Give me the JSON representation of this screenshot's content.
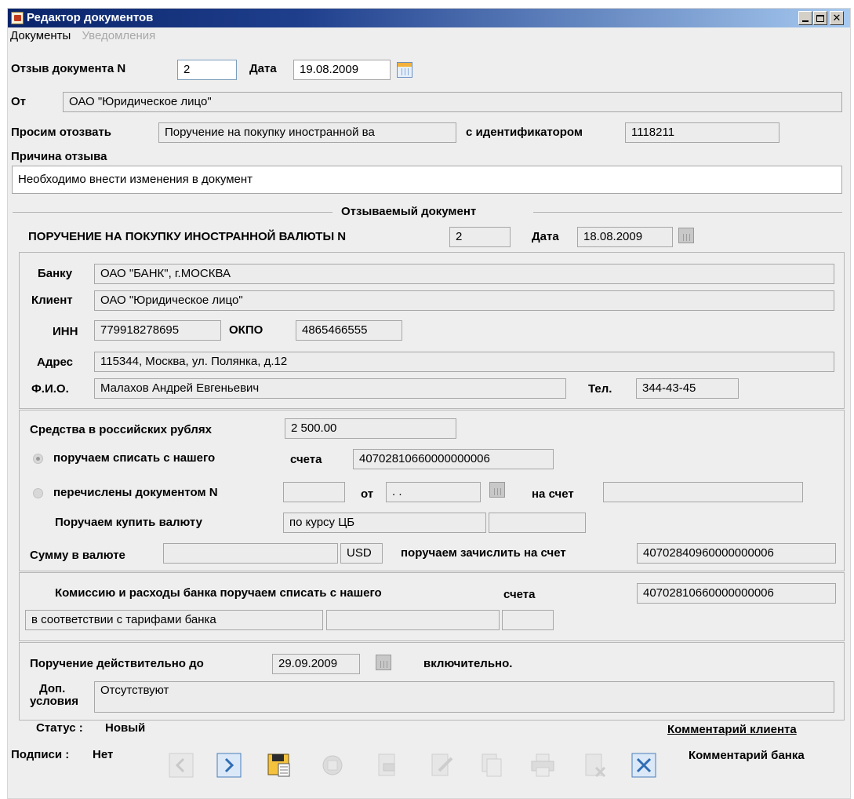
{
  "window": {
    "title": "Редактор документов"
  },
  "menu": {
    "items": [
      {
        "label": "Документы",
        "enabled": true
      },
      {
        "label": "Уведомления",
        "enabled": false
      }
    ]
  },
  "recall": {
    "doc_number_label": "Отзыв документа N",
    "doc_number_value": "2",
    "date_label": "Дата",
    "date_value": "19.08.2009",
    "from_label": "От",
    "from_value": "ОАО \"Юридическое лицо\"",
    "request_label": "Просим отозвать",
    "request_value": "Поручение на покупку иностранной ва",
    "identifier_label": "с идентификатором",
    "identifier_value": "1118211",
    "reason_label": "Причина отзыва",
    "reason_value": "Необходимо внести изменения в документ"
  },
  "recalled_doc": {
    "section_title": "Отзываемый документ",
    "heading": "ПОРУЧЕНИЕ НА ПОКУПКУ ИНОСТРАННОЙ ВАЛЮТЫ N",
    "number_value": "2",
    "date_label": "Дата",
    "date_value": "18.08.2009",
    "bank_label": "Банку",
    "bank_value": "ОАО \"БАНК\", г.МОСКВА",
    "client_label": "Клиент",
    "client_value": "ОАО \"Юридическое лицо\"",
    "inn_label": "ИНН",
    "inn_value": "779918278695",
    "okpo_label": "ОКПО",
    "okpo_value": "4865466555",
    "address_label": "Адрес",
    "address_value": "115344, Москва, ул. Полянка, д.12",
    "fio_label": "Ф.И.О.",
    "fio_value": "Малахов Андрей Евгеньевич",
    "phone_label": "Тел.",
    "phone_value": "344-43-45",
    "rub_funds_label": "Средства в российских рублях",
    "rub_funds_value": "2 500.00",
    "debit_option_label": "поручаем списать с нашего",
    "debit_account_label": "счета",
    "debit_account_value": "40702810660000000006",
    "transferred_option_label": "перечислены документом N",
    "transferred_doc_value": "",
    "from_label": "от",
    "from_date_value": " .  .",
    "to_account_label": "на счет",
    "to_account_value": "",
    "buy_currency_label": "Поручаем купить валюту",
    "rate_value": "по курсу ЦБ",
    "rate_extra_value": "",
    "currency_amount_label": "Сумму в валюте",
    "currency_amount_value": "",
    "currency_code": "USD",
    "credit_label": "поручаем зачислить на  счет",
    "credit_account_value": "40702840960000000006",
    "commission_label": "Комиссию и расходы банка поручаем списать с нашего",
    "commission_account_label": "счета",
    "commission_account_value": "40702810660000000006",
    "commission_basis_value": "в соответствии с тарифами банка",
    "commission_extra_1": "",
    "commission_extra_2": "",
    "valid_until_label": "Поручение действительно до",
    "valid_until_value": "29.09.2009",
    "inclusive_label": "включительно.",
    "extra_conditions_label_1": "Доп.",
    "extra_conditions_label_2": "условия",
    "extra_conditions_value": "Отсутствуют"
  },
  "footer": {
    "status_label": "Статус :",
    "status_value": "Новый",
    "signatures_label": "Подписи :",
    "signatures_value": "Нет",
    "client_comment_link": "Комментарий клиента",
    "bank_comment_label": "Комментарий банка"
  },
  "toolbar": {
    "buttons": [
      {
        "icon": "prev-icon",
        "enabled": false
      },
      {
        "icon": "next-icon",
        "enabled": true
      },
      {
        "icon": "save-icon",
        "enabled": true
      },
      {
        "icon": "sign-icon",
        "enabled": false
      },
      {
        "icon": "document-icon",
        "enabled": false
      },
      {
        "icon": "edit-icon",
        "enabled": false
      },
      {
        "icon": "copy-icon",
        "enabled": false
      },
      {
        "icon": "print-icon",
        "enabled": false
      },
      {
        "icon": "delete-icon",
        "enabled": false
      },
      {
        "icon": "close-icon",
        "enabled": true
      }
    ]
  },
  "colors": {
    "titlebar_start": "#0a246a",
    "titlebar_end": "#a6caf0",
    "window_bg": "#eeeeee",
    "field_bg": "#ececec",
    "accent_blue": "#2f6db5"
  }
}
